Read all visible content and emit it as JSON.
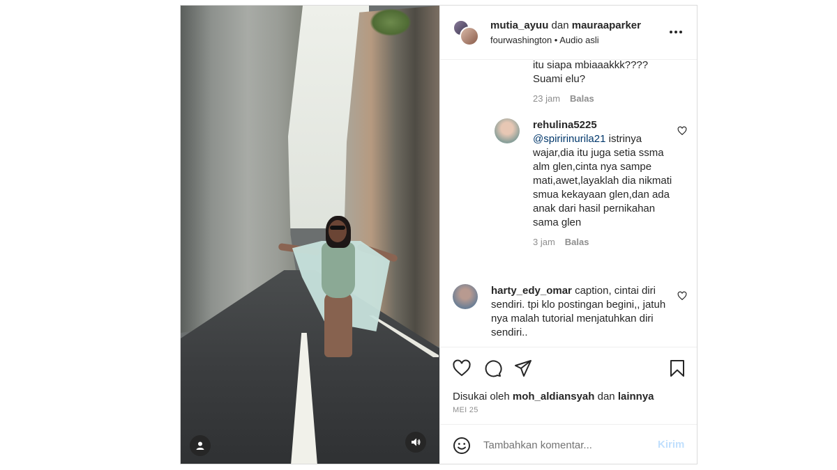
{
  "header": {
    "user_a": "mutia_ayuu",
    "joiner": "dan",
    "user_b": "mauraaparker",
    "sub_user": "fourwashington",
    "separator": "•",
    "audio": "Audio asli",
    "more_icon": "more-horizontal-icon"
  },
  "comments": {
    "c0": {
      "text": "itu siapa mbiaaakkk???? Suami elu?",
      "time": "23 jam",
      "reply": "Balas"
    },
    "c1": {
      "user": "rehulina5225",
      "mention": "@spiririnurila21",
      "text": " istrinya wajar,dia itu juga setia ssma alm glen,cinta nya sampe mati,awet,layaklah dia nikmati smua kekayaan glen,dan ada anak dari hasil pernikahan sama glen",
      "time": "3 jam",
      "reply": "Balas"
    },
    "c2": {
      "user": "harty_edy_omar",
      "text": " caption, cintai diri sendiri. tpi klo postingan begini,, jatuh nya malah tutorial menjatuhkan diri sendiri.."
    }
  },
  "likes": {
    "prefix": "Disukai oleh ",
    "user": "moh_aldiansyah",
    "joiner": " dan ",
    "others": "lainnya"
  },
  "date": "MEI 25",
  "composer": {
    "placeholder": "Tambahkan komentar...",
    "post": "Kirim"
  },
  "colors": {
    "text": "#262626",
    "muted": "#8e8e8e",
    "mention": "#00376b",
    "post_disabled": "#c0dffd",
    "border": "#dbdbdb"
  },
  "icons": [
    "user-tag-icon",
    "audio-icon",
    "heart-icon",
    "comment-icon",
    "share-icon",
    "bookmark-icon",
    "emoji-icon"
  ]
}
